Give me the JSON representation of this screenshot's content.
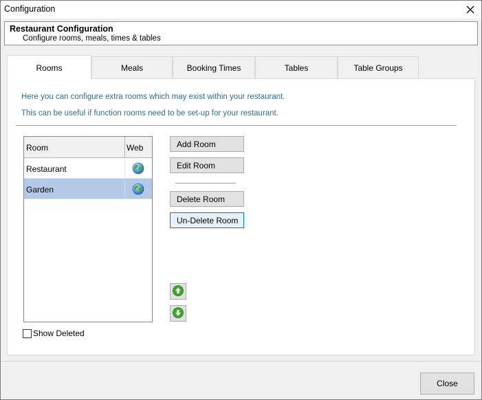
{
  "window": {
    "title": "Configuration",
    "close_icon": "close-icon"
  },
  "header": {
    "title": "Restaurant Configuration",
    "subtitle": "Configure rooms, meals, times & tables"
  },
  "tabs": [
    {
      "label": "Rooms",
      "active": true
    },
    {
      "label": "Meals",
      "active": false
    },
    {
      "label": "Booking Times",
      "active": false
    },
    {
      "label": "Tables",
      "active": false
    },
    {
      "label": "Table Groups",
      "active": false
    }
  ],
  "rooms_tab": {
    "info_line_1": "Here you can configure extra rooms which may exist within your restaurant.",
    "info_line_2": "This can be useful if function rooms need to be set-up for your restaurant.",
    "grid": {
      "columns": [
        "Room",
        "Web"
      ],
      "rows": [
        {
          "name": "Restaurant",
          "web_icon": "globe-icon",
          "selected": false
        },
        {
          "name": "Garden",
          "web_icon": "globe-icon",
          "selected": true
        }
      ]
    },
    "buttons": {
      "add": "Add Room",
      "edit": "Edit Room",
      "delete": "Delete Room",
      "undelete": "Un-Delete Room"
    },
    "move_up_icon": "arrow-up-icon",
    "move_down_icon": "arrow-down-icon",
    "show_deleted": {
      "label": "Show Deleted",
      "checked": false
    }
  },
  "footer": {
    "close_label": "Close"
  },
  "colors": {
    "info_text": "#2e6d9c",
    "selected_row": "#b4c8e8",
    "focused_button_border": "#0078d7"
  }
}
